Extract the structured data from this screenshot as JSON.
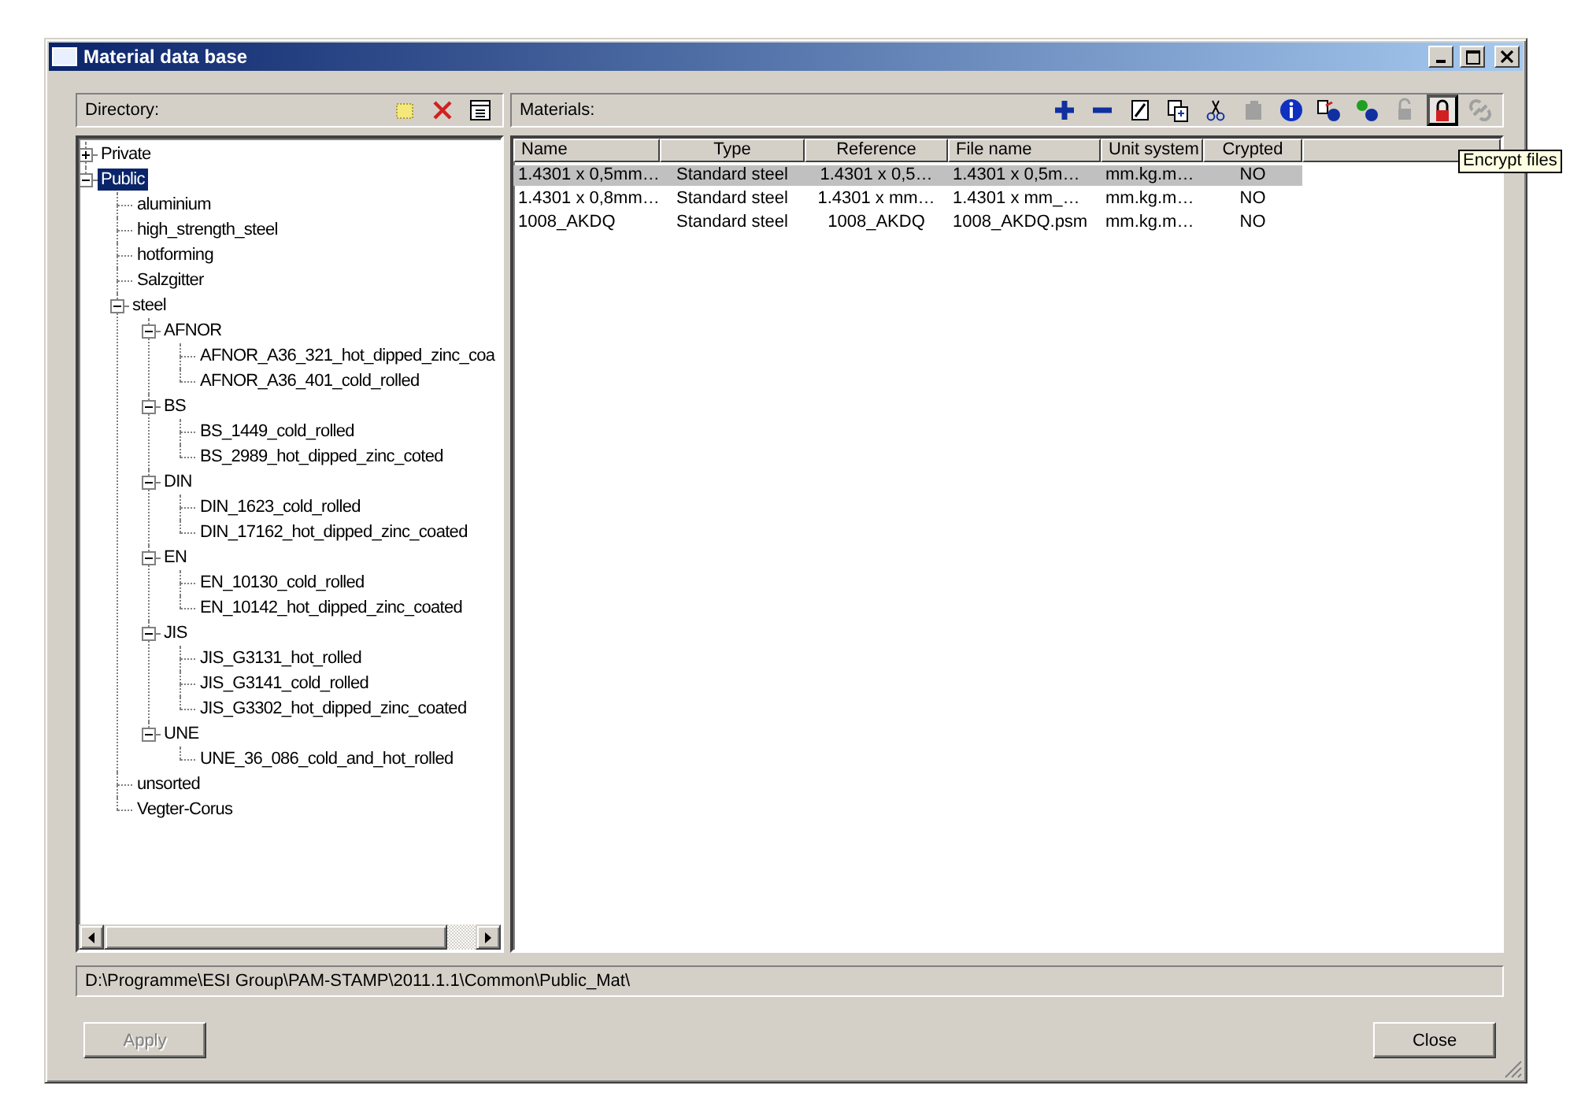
{
  "window": {
    "title": "Material data base"
  },
  "directory": {
    "label": "Directory:",
    "tools": [
      {
        "kind": "new-folder",
        "disabled": false
      },
      {
        "kind": "delete",
        "disabled": false
      },
      {
        "kind": "properties",
        "disabled": false
      }
    ],
    "tree": [
      {
        "label": "Private",
        "expanded": false,
        "selected": false
      },
      {
        "label": "Public",
        "expanded": true,
        "selected": true,
        "children": [
          {
            "label": "aluminium",
            "selected": false
          },
          {
            "label": "high_strength_steel",
            "selected": false
          },
          {
            "label": "hotforming",
            "selected": false
          },
          {
            "label": "Salzgitter",
            "selected": false
          },
          {
            "label": "steel",
            "expanded": true,
            "selected": false,
            "children": [
              {
                "label": "AFNOR",
                "expanded": true,
                "selected": false,
                "children": [
                  {
                    "label": "AFNOR_A36_321_hot_dipped_zinc_coa",
                    "selected": false
                  },
                  {
                    "label": "AFNOR_A36_401_cold_rolled",
                    "selected": false
                  }
                ]
              },
              {
                "label": "BS",
                "expanded": true,
                "selected": false,
                "children": [
                  {
                    "label": "BS_1449_cold_rolled",
                    "selected": false
                  },
                  {
                    "label": "BS_2989_hot_dipped_zinc_coted",
                    "selected": false
                  }
                ]
              },
              {
                "label": "DIN",
                "expanded": true,
                "selected": false,
                "children": [
                  {
                    "label": "DIN_1623_cold_rolled",
                    "selected": false
                  },
                  {
                    "label": "DIN_17162_hot_dipped_zinc_coated",
                    "selected": false
                  }
                ]
              },
              {
                "label": "EN",
                "expanded": true,
                "selected": false,
                "children": [
                  {
                    "label": "EN_10130_cold_rolled",
                    "selected": false
                  },
                  {
                    "label": "EN_10142_hot_dipped_zinc_coated",
                    "selected": false
                  }
                ]
              },
              {
                "label": "JIS",
                "expanded": true,
                "selected": false,
                "children": [
                  {
                    "label": "JIS_G3131_hot_rolled",
                    "selected": false
                  },
                  {
                    "label": "JIS_G3141_cold_rolled",
                    "selected": false
                  },
                  {
                    "label": "JIS_G3302_hot_dipped_zinc_coated",
                    "selected": false
                  }
                ]
              },
              {
                "label": "UNE",
                "expanded": true,
                "selected": false,
                "children": [
                  {
                    "label": "UNE_36_086_cold_and_hot_rolled",
                    "selected": false
                  }
                ]
              }
            ]
          },
          {
            "label": "unsorted",
            "selected": false
          },
          {
            "label": "Vegter-Corus",
            "selected": false
          }
        ]
      }
    ]
  },
  "materials": {
    "label": "Materials:",
    "tools": [
      {
        "kind": "add",
        "disabled": false,
        "pressed": false
      },
      {
        "kind": "remove",
        "disabled": false,
        "pressed": false
      },
      {
        "kind": "edit",
        "disabled": false,
        "pressed": false
      },
      {
        "kind": "copy",
        "disabled": false,
        "pressed": false
      },
      {
        "kind": "cut",
        "disabled": false,
        "pressed": false
      },
      {
        "kind": "paste",
        "disabled": true,
        "pressed": false
      },
      {
        "kind": "info",
        "disabled": false,
        "pressed": false
      },
      {
        "kind": "export",
        "disabled": false,
        "pressed": false
      },
      {
        "kind": "import",
        "disabled": false,
        "pressed": false
      },
      {
        "kind": "unlock",
        "disabled": true,
        "pressed": false
      },
      {
        "kind": "lock",
        "disabled": false,
        "pressed": true
      },
      {
        "kind": "link",
        "disabled": true,
        "pressed": false
      }
    ],
    "tooltip": "Encrypt files",
    "columns": [
      "Name",
      "Type",
      "Reference",
      "File name",
      "Unit system",
      "Crypted"
    ],
    "rows": [
      {
        "selected": true,
        "cells": [
          "1.4301 x 0,5mm…",
          "Standard steel",
          "1.4301 x 0,5…",
          "1.4301 x 0,5m…",
          "mm.kg.m…",
          "NO"
        ]
      },
      {
        "selected": false,
        "cells": [
          "1.4301 x 0,8mm…",
          "Standard steel",
          "1.4301 x mm…",
          "1.4301 x mm_…",
          "mm.kg.m…",
          "NO"
        ]
      },
      {
        "selected": false,
        "cells": [
          "1008_AKDQ",
          "Standard steel",
          "1008_AKDQ",
          "1008_AKDQ.psm",
          "mm.kg.m…",
          "NO"
        ]
      }
    ]
  },
  "path": "D:\\Programme\\ESI Group\\PAM-STAMP\\2011.1.1\\Common\\Public_Mat\\",
  "buttons": [
    {
      "label": "Apply",
      "disabled": true
    },
    {
      "label": "Close",
      "disabled": false
    }
  ]
}
